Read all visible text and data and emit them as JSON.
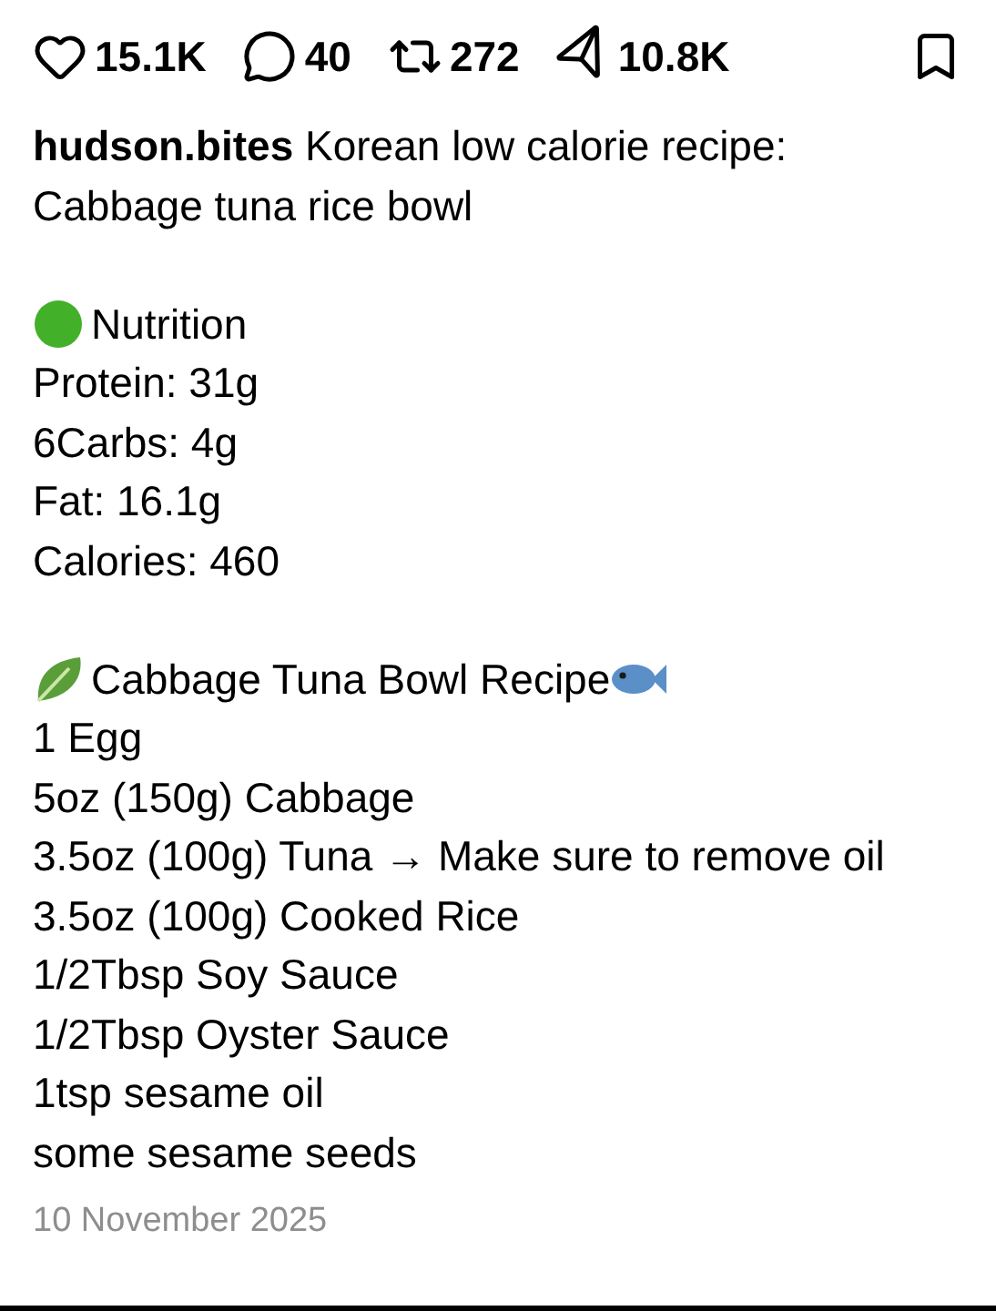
{
  "actions": [
    {
      "kind": "like",
      "count": "15.1K"
    },
    {
      "kind": "comment",
      "count": "40"
    },
    {
      "kind": "repost",
      "count": "272"
    },
    {
      "kind": "share",
      "count": "10.8K"
    }
  ],
  "caption": {
    "username": "hudson.bites",
    "text": "Korean low calorie recipe: Cabbage tuna rice bowl"
  },
  "sections": [
    {
      "heading": {
        "kind": "nutrition",
        "text": "Nutrition"
      },
      "lines": [
        "Protein: 31g",
        "6Carbs: 4g",
        "Fat: 16.1g",
        "Calories: 460"
      ]
    },
    {
      "heading": {
        "kind": "recipe",
        "text": "Cabbage Tuna Bowl Recipe"
      },
      "lines": [
        "1 Egg",
        "5oz (150g) Cabbage",
        "3.5oz (100g) Tuna → Make sure to remove oil",
        "3.5oz (100g) Cooked Rice",
        "1/2Tbsp Soy Sauce",
        "1/2Tbsp Oyster Sauce",
        "1tsp sesame oil",
        "some sesame seeds"
      ]
    }
  ],
  "date": "10 November 2025"
}
